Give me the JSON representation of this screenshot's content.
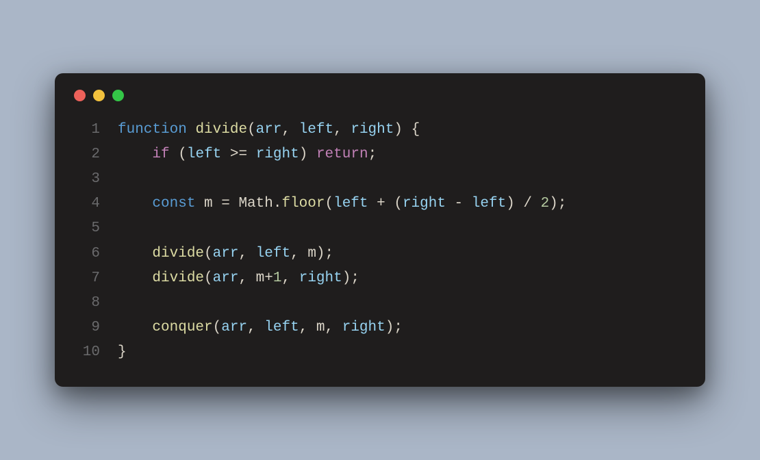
{
  "window": {
    "controls": [
      "close",
      "minimize",
      "zoom"
    ]
  },
  "code": {
    "lines": [
      {
        "num": "1",
        "tokens": [
          {
            "cls": "tok-keyword",
            "t": "function"
          },
          {
            "cls": "tok-default",
            "t": " "
          },
          {
            "cls": "tok-funcname",
            "t": "divide"
          },
          {
            "cls": "tok-default",
            "t": "("
          },
          {
            "cls": "tok-param",
            "t": "arr"
          },
          {
            "cls": "tok-default",
            "t": ", "
          },
          {
            "cls": "tok-param",
            "t": "left"
          },
          {
            "cls": "tok-default",
            "t": ", "
          },
          {
            "cls": "tok-param",
            "t": "right"
          },
          {
            "cls": "tok-default",
            "t": ") {"
          }
        ]
      },
      {
        "num": "2",
        "tokens": [
          {
            "cls": "tok-default",
            "t": "    "
          },
          {
            "cls": "tok-control",
            "t": "if"
          },
          {
            "cls": "tok-default",
            "t": " ("
          },
          {
            "cls": "tok-param",
            "t": "left"
          },
          {
            "cls": "tok-default",
            "t": " >= "
          },
          {
            "cls": "tok-param",
            "t": "right"
          },
          {
            "cls": "tok-default",
            "t": ") "
          },
          {
            "cls": "tok-control",
            "t": "return"
          },
          {
            "cls": "tok-default",
            "t": ";"
          }
        ]
      },
      {
        "num": "3",
        "tokens": []
      },
      {
        "num": "4",
        "tokens": [
          {
            "cls": "tok-default",
            "t": "    "
          },
          {
            "cls": "tok-keyword",
            "t": "const"
          },
          {
            "cls": "tok-default",
            "t": " m = Math."
          },
          {
            "cls": "tok-funcname",
            "t": "floor"
          },
          {
            "cls": "tok-default",
            "t": "("
          },
          {
            "cls": "tok-param",
            "t": "left"
          },
          {
            "cls": "tok-default",
            "t": " + ("
          },
          {
            "cls": "tok-param",
            "t": "right"
          },
          {
            "cls": "tok-default",
            "t": " - "
          },
          {
            "cls": "tok-param",
            "t": "left"
          },
          {
            "cls": "tok-default",
            "t": ") / "
          },
          {
            "cls": "tok-number",
            "t": "2"
          },
          {
            "cls": "tok-default",
            "t": ");"
          }
        ]
      },
      {
        "num": "5",
        "tokens": []
      },
      {
        "num": "6",
        "tokens": [
          {
            "cls": "tok-default",
            "t": "    "
          },
          {
            "cls": "tok-funcname",
            "t": "divide"
          },
          {
            "cls": "tok-default",
            "t": "("
          },
          {
            "cls": "tok-param",
            "t": "arr"
          },
          {
            "cls": "tok-default",
            "t": ", "
          },
          {
            "cls": "tok-param",
            "t": "left"
          },
          {
            "cls": "tok-default",
            "t": ", m);"
          }
        ]
      },
      {
        "num": "7",
        "tokens": [
          {
            "cls": "tok-default",
            "t": "    "
          },
          {
            "cls": "tok-funcname",
            "t": "divide"
          },
          {
            "cls": "tok-default",
            "t": "("
          },
          {
            "cls": "tok-param",
            "t": "arr"
          },
          {
            "cls": "tok-default",
            "t": ", m+"
          },
          {
            "cls": "tok-number",
            "t": "1"
          },
          {
            "cls": "tok-default",
            "t": ", "
          },
          {
            "cls": "tok-param",
            "t": "right"
          },
          {
            "cls": "tok-default",
            "t": ");"
          }
        ]
      },
      {
        "num": "8",
        "tokens": []
      },
      {
        "num": "9",
        "tokens": [
          {
            "cls": "tok-default",
            "t": "    "
          },
          {
            "cls": "tok-funcname",
            "t": "conquer"
          },
          {
            "cls": "tok-default",
            "t": "("
          },
          {
            "cls": "tok-param",
            "t": "arr"
          },
          {
            "cls": "tok-default",
            "t": ", "
          },
          {
            "cls": "tok-param",
            "t": "left"
          },
          {
            "cls": "tok-default",
            "t": ", m, "
          },
          {
            "cls": "tok-param",
            "t": "right"
          },
          {
            "cls": "tok-default",
            "t": ");"
          }
        ]
      },
      {
        "num": "10",
        "tokens": [
          {
            "cls": "tok-default",
            "t": "}"
          }
        ]
      }
    ]
  }
}
